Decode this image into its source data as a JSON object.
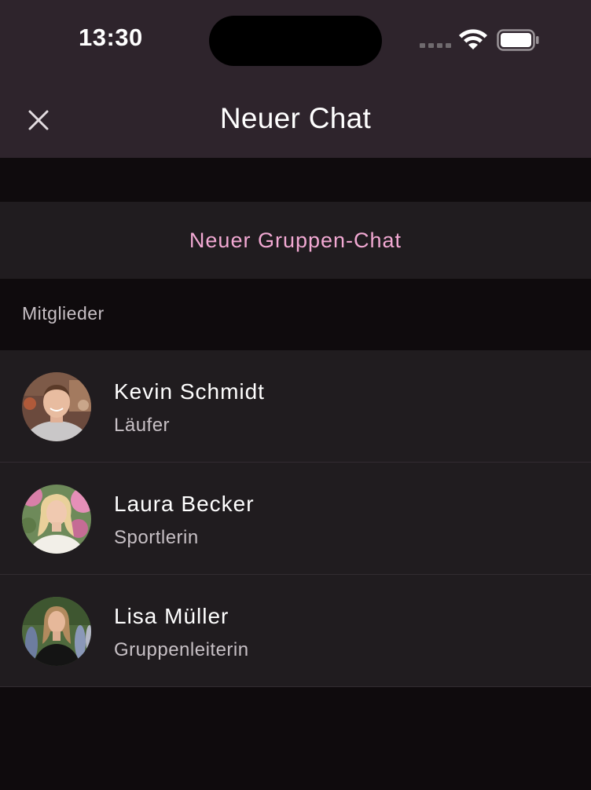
{
  "status_bar": {
    "time": "13:30"
  },
  "header": {
    "title": "Neuer Chat",
    "close_icon": "close-icon"
  },
  "group_chat": {
    "label": "Neuer Gruppen-Chat",
    "color": "#f2a9d3"
  },
  "section": {
    "label": "Mitglieder"
  },
  "members": [
    {
      "name": "Kevin Schmidt",
      "role": "Läufer",
      "avatar": "avatar-photo"
    },
    {
      "name": "Laura Becker",
      "role": "Sportlerin",
      "avatar": "avatar-photo"
    },
    {
      "name": "Lisa Müller",
      "role": "Gruppenleiterin",
      "avatar": "avatar-photo"
    }
  ],
  "colors": {
    "header_bg": "#2e242c",
    "row_bg": "#201c1f",
    "page_bg": "#0f0b0d"
  }
}
